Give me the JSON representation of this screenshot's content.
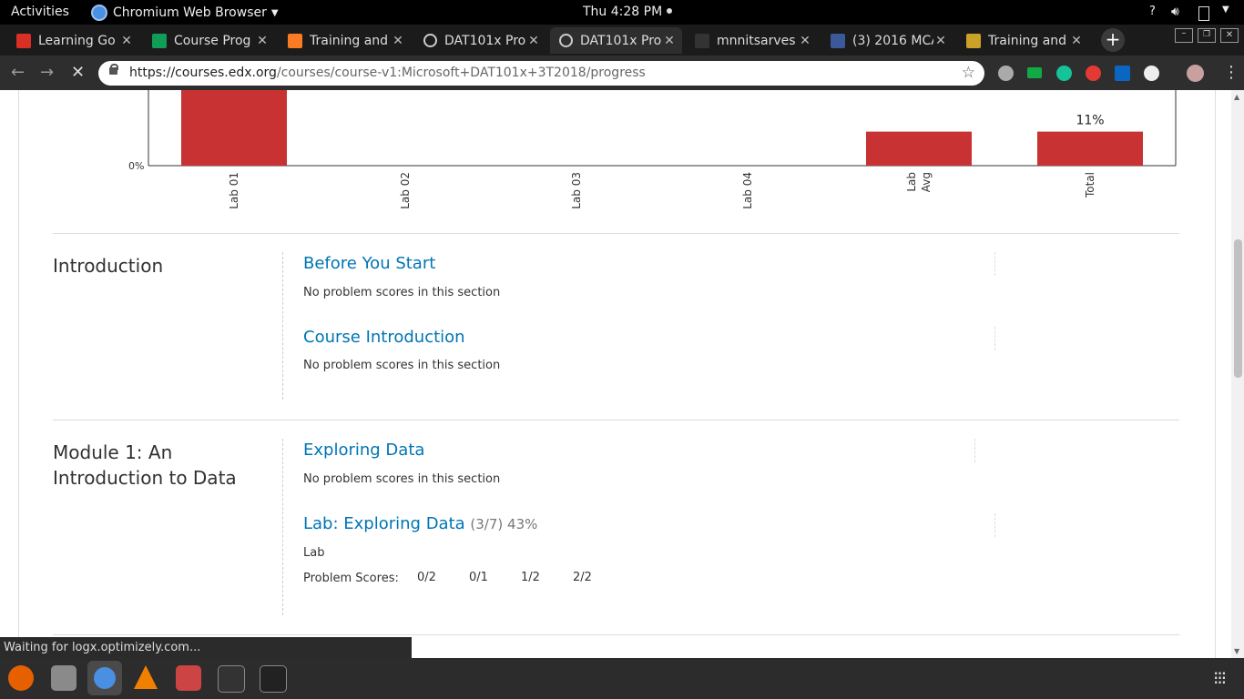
{
  "system": {
    "activities": "Activities",
    "app_name": "Chromium Web Browser",
    "clock": "Thu  4:28 PM"
  },
  "tabs": [
    {
      "title": "Learning Go",
      "icon": "gmail-icon",
      "color": "#d93025"
    },
    {
      "title": "Course Prog",
      "icon": "f8-icon",
      "color": "#0f9d58"
    },
    {
      "title": "Training and",
      "icon": "xampp-icon",
      "color": "#fb7a24"
    },
    {
      "title": "DAT101x Pro",
      "icon": "loading-icon",
      "color": "#cccccc"
    },
    {
      "title": "DAT101x Pro",
      "icon": "loading-icon",
      "color": "#cccccc"
    },
    {
      "title": "mnnitsarves",
      "icon": "github-icon",
      "color": "#333333"
    },
    {
      "title": "(3) 2016 MCA",
      "icon": "facebook-icon",
      "color": "#3b5998"
    },
    {
      "title": "Training and",
      "icon": "emblem-icon",
      "color": "#c9a227"
    }
  ],
  "address_bar": {
    "url_host": "https://courses.edx.org",
    "url_path": "/courses/course-v1:Microsoft+DAT101x+3T2018/progress"
  },
  "chart_data": {
    "type": "bar",
    "categories": [
      "Lab 01",
      "Lab 02",
      "Lab 03",
      "Lab 04",
      "Lab Avg",
      "Total"
    ],
    "values": [
      null,
      0,
      0,
      0,
      11,
      11
    ],
    "visible_value_labels": {
      "Total": "11%"
    },
    "y_tick_label": "0%",
    "bar_color": "#c83232"
  },
  "sections": [
    {
      "title": "Introduction",
      "subsections": [
        {
          "title": "Before You Start",
          "note": "No problem scores in this section"
        },
        {
          "title": "Course Introduction",
          "note": "No problem scores in this section"
        }
      ]
    },
    {
      "title": "Module 1: An Introduction to Data",
      "subsections": [
        {
          "title": "Exploring Data",
          "note": "No problem scores in this section"
        },
        {
          "title": "Lab: Exploring Data",
          "score": "(3/7) 43%",
          "type": "Lab",
          "scores_label": "Problem Scores:",
          "scores": [
            "0/2",
            "0/1",
            "1/2",
            "2/2"
          ]
        }
      ]
    }
  ],
  "status_bar": "Waiting for logx.optimizely.com..."
}
